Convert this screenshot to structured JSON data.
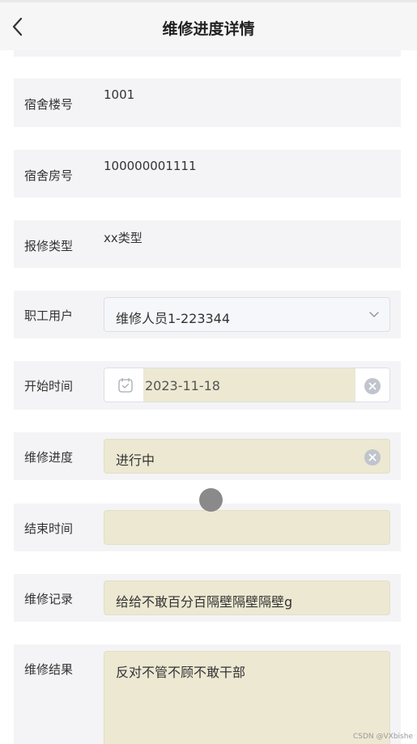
{
  "header": {
    "title": "维修进度详情"
  },
  "fields": {
    "building": {
      "label": "宿舍楼号",
      "value": "1001"
    },
    "room": {
      "label": "宿舍房号",
      "value": "100000001111"
    },
    "repair_type": {
      "label": "报修类型",
      "value": "xx类型"
    },
    "staff": {
      "label": "职工用户",
      "value": "维修人员1-223344"
    },
    "start_time": {
      "label": "开始时间",
      "value": "2023-11-18"
    },
    "progress": {
      "label": "维修进度",
      "value": "进行中"
    },
    "end_time": {
      "label": "结束时间",
      "value": ""
    },
    "record": {
      "label": "维修记录",
      "value": "给给不敢百分百隔壁隔壁隔壁g"
    },
    "result": {
      "label": "维修结果",
      "value": "反对不管不顾不敢干部"
    }
  },
  "icons": {
    "back": "chevron-left-icon",
    "select": "chevron-down-icon",
    "calendar": "calendar-icon",
    "clear": "clear-circle-icon"
  },
  "colors": {
    "row_background": "#f4f4f6",
    "filled_field": "#ece8d2",
    "header_background": "#f6f6f6"
  },
  "watermark": "CSDN @VXbishe"
}
